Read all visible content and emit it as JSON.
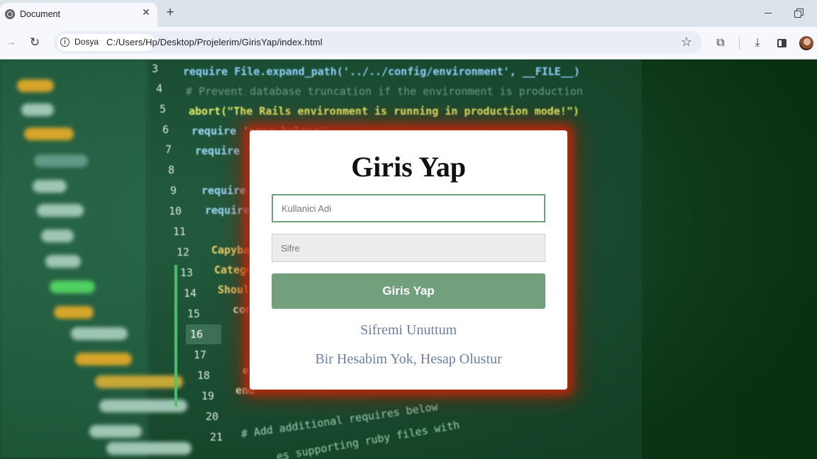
{
  "browser": {
    "tab_title": "Document",
    "tab_close": "✕",
    "new_tab": "+",
    "forward_glyph": "→",
    "reload_glyph": "↻",
    "security_chip_label": "Dosya",
    "url": "C:/Users/Hp/Desktop/Projelerim/GirisYap/index.html",
    "star_glyph": "☆",
    "extensions_glyph": "⧉",
    "download_glyph": "⤓"
  },
  "background_code": {
    "line_numbers": [
      "3",
      "4",
      "5",
      "6",
      "7",
      "8",
      "9",
      "10",
      "11",
      "12",
      "13",
      "14",
      "15",
      "16",
      "17",
      "18",
      "19",
      "20",
      "21"
    ],
    "visible_code": [
      "require File.expand_path('../../config/environment', __FILE__)",
      "# Prevent database truncation if the environment is production",
      "abort(\"The Rails environment is running in production mode!\")",
      "require 'spec_helper'",
      "require 'r",
      "require '",
      "require '",
      "Capybar",
      "Catego",
      "Should",
      "con",
      "e",
      "end",
      "# Add additional requires below",
      "es supporting ruby files with"
    ]
  },
  "login": {
    "title": "Giris Yap",
    "username_placeholder": "Kullanici Adi",
    "password_placeholder": "Sifre",
    "submit_label": "Giris Yap",
    "forgot_password_link": "Sifremi Unuttum",
    "register_link": "Bir Hesabim Yok, Hesap Olustur"
  },
  "colors": {
    "submit_bg": "#73a07c",
    "link": "#6c7fa8",
    "card_glow": "#be280a",
    "username_border": "#6f9f7c"
  }
}
